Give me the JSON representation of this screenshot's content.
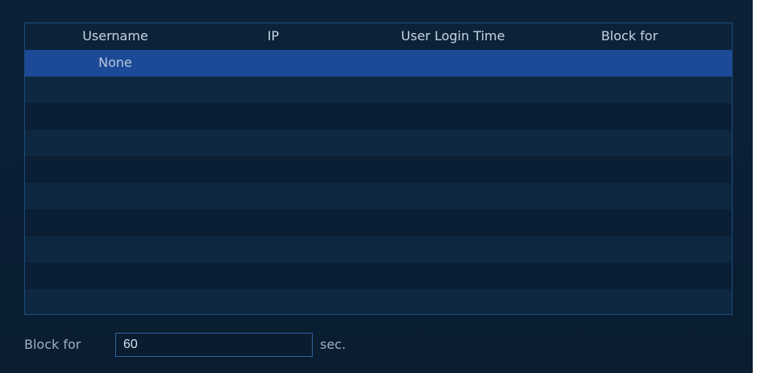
{
  "table": {
    "columns": [
      "Username",
      "IP",
      "User Login Time",
      "Block for"
    ],
    "rows": [
      {
        "username": "None",
        "ip": "",
        "login_time": "",
        "block_for": "",
        "selected": true
      }
    ],
    "empty_row_count": 9
  },
  "block_setting": {
    "label": "Block for",
    "value": "60",
    "unit": "sec."
  }
}
